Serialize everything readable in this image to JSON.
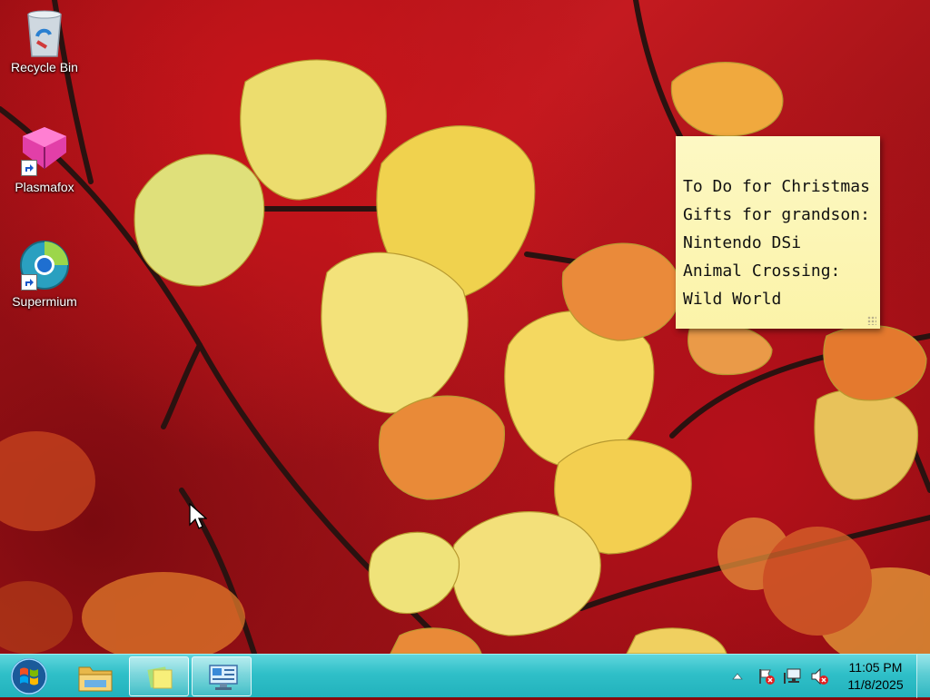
{
  "desktop": {
    "icons": [
      {
        "label": "Recycle Bin",
        "icon": "recycle-bin-icon"
      },
      {
        "label": "Plasmafox",
        "icon": "plasmafox-icon"
      },
      {
        "label": "Supermium",
        "icon": "supermium-icon"
      }
    ]
  },
  "sticky_note": {
    "lines": [
      "To Do for Christmas",
      "Gifts for grandson:",
      "Nintendo DSi",
      "Animal Crossing: Wild World"
    ],
    "background": "#fbf3a8"
  },
  "taskbar": {
    "color": "#2fbfc8",
    "start_icon": "windows-logo-icon",
    "pinned": [
      {
        "name": "file-explorer",
        "icon": "folder-icon"
      },
      {
        "name": "sticky-notes",
        "icon": "sticky-notes-icon"
      },
      {
        "name": "control-panel",
        "icon": "control-panel-icon"
      }
    ],
    "tray": {
      "icons": [
        "show-hidden-icons-icon",
        "action-center-flag-icon",
        "network-icon",
        "volume-muted-icon"
      ],
      "time": "11:05 PM",
      "date": "11/8/2025"
    }
  }
}
